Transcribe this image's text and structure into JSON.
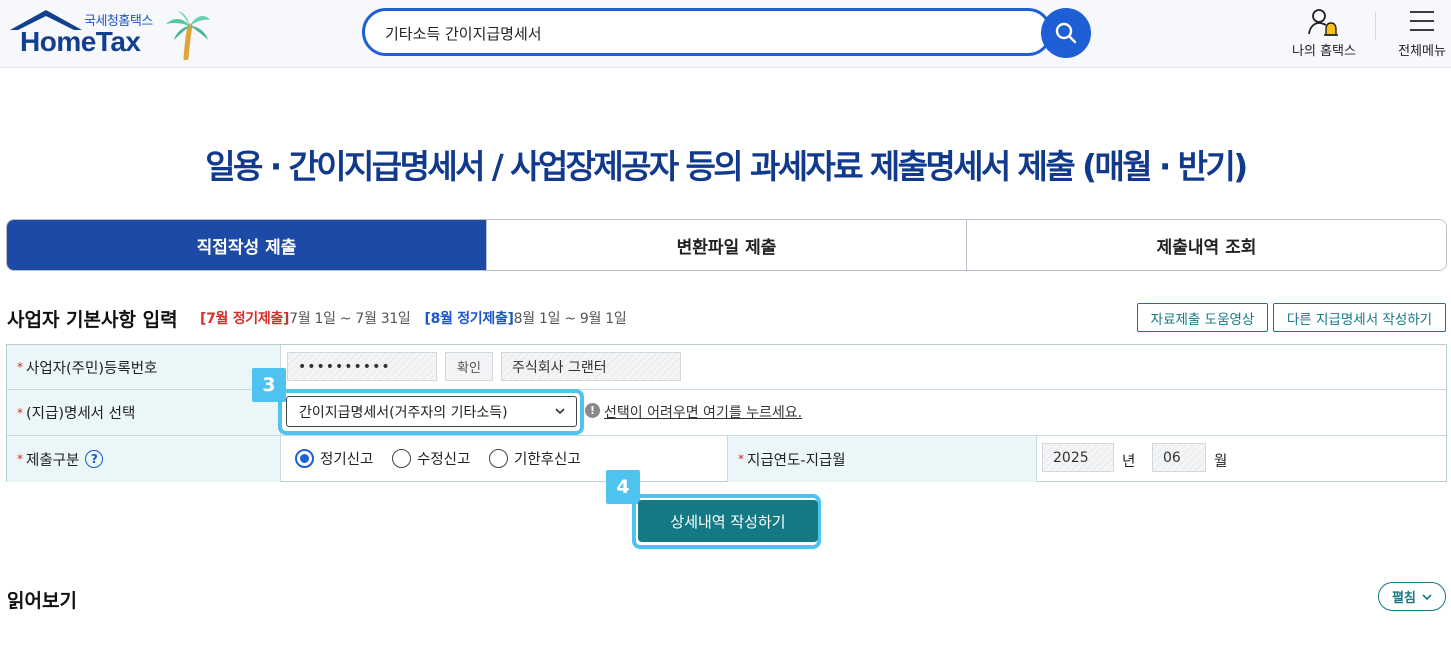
{
  "header": {
    "logo_sub": "국세청홈택스",
    "logo_main": "HomeTax",
    "search_value": "기타소득 간이지급명세서",
    "my_hometax_label": "나의 홈택스",
    "all_menu_label": "전체메뉴"
  },
  "page_title": "일용 · 간이지급명세서 / 사업장제공자 등의 과세자료 제출명세서 제출 (매월 · 반기)",
  "tabs": [
    {
      "label": "직접작성 제출",
      "active": true
    },
    {
      "label": "변환파일 제출",
      "active": false
    },
    {
      "label": "제출내역 조회",
      "active": false
    }
  ],
  "section": {
    "title": "사업자 기본사항 입력",
    "july_tag": "[7월 정기제출]",
    "july_range": "7월 1일 ~ 7월 31일",
    "aug_tag": "[8월 정기제출]",
    "aug_range": "8월 1일 ~ 9월 1일",
    "help_video_button": "자료제출 도움영상",
    "other_form_button": "다른 지급명세서 작성하기"
  },
  "form": {
    "biz_no": {
      "label": "사업자(주민)등록번호",
      "value": "••••••••••",
      "confirm_button": "확인",
      "company_name": "주식회사 그랜터"
    },
    "statement_type": {
      "label": "(지급)명세서 선택",
      "selected": "간이지급명세서(거주자의 기타소득)",
      "help_link": "선택이 어려우면 여기를 누르세요."
    },
    "submit_type": {
      "label": "제출구분",
      "options": [
        {
          "label": "정기신고",
          "checked": true
        },
        {
          "label": "수정신고",
          "checked": false
        },
        {
          "label": "기한후신고",
          "checked": false
        }
      ]
    },
    "pay_period": {
      "label": "지급연도-지급월",
      "year": "2025",
      "year_unit": "년",
      "month": "06",
      "month_unit": "월"
    }
  },
  "step_badges": {
    "select_step": "3",
    "write_step": "4"
  },
  "primary_button": "상세내역 작성하기",
  "read_more": {
    "title": "읽어보기",
    "expand_button": "펼침"
  },
  "colors": {
    "primary_blue": "#1d4aa6",
    "teal": "#137a85",
    "highlight": "#4fc3f0",
    "required_red": "#d62d2d"
  }
}
